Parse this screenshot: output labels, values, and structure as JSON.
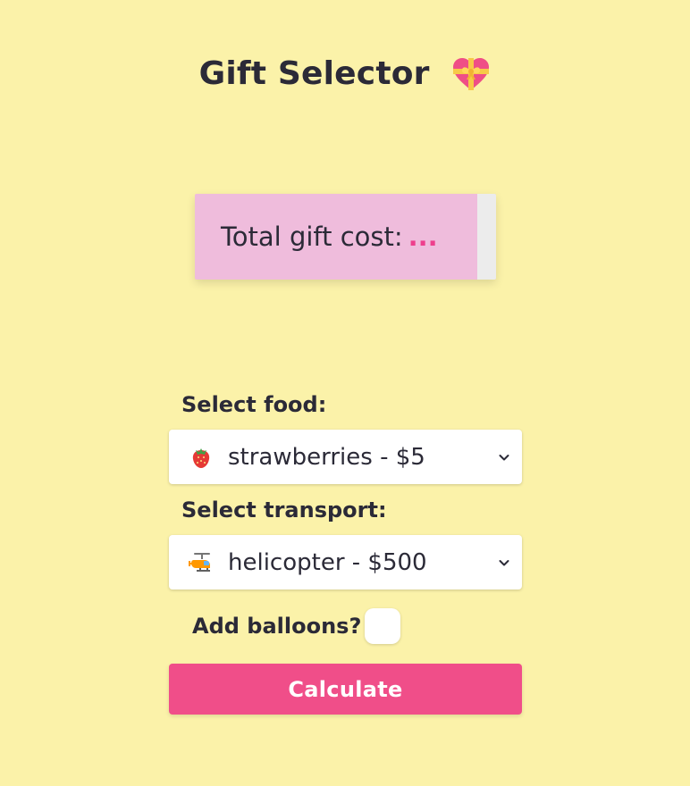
{
  "page": {
    "title": "Gift Selector",
    "title_icon": "heart-with-ribbon-icon"
  },
  "result": {
    "label": "Total gift cost:",
    "value": "..."
  },
  "food": {
    "label": "Select food:",
    "selected": "strawberries - $5",
    "icon": "strawberry-icon"
  },
  "transport": {
    "label": "Select transport:",
    "selected": "helicopter - $500",
    "icon": "helicopter-icon"
  },
  "balloons": {
    "label": "Add balloons?",
    "checked": false
  },
  "actions": {
    "calculate_label": "Calculate"
  },
  "colors": {
    "background": "#fbf2a9",
    "card": "#efbcdc",
    "accent": "#f04e89",
    "text": "#2b2a37"
  }
}
